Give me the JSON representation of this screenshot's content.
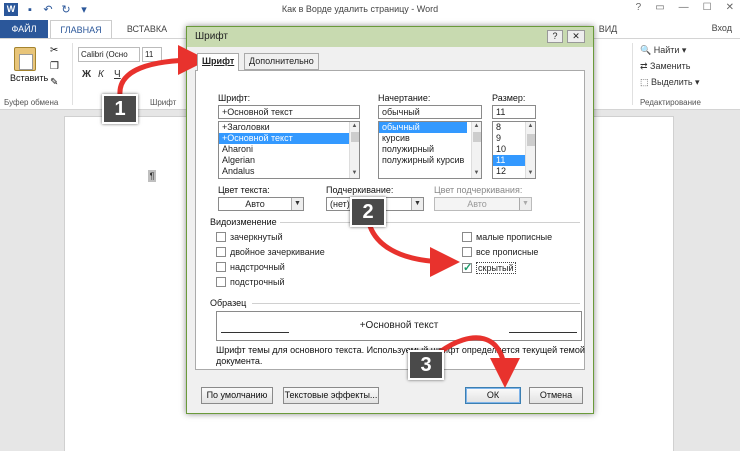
{
  "window": {
    "title": "Как в Ворде удалить страницу - Word",
    "signin": "Вход",
    "word_logo": "W",
    "controls": [
      "?",
      "▭",
      "—",
      "☐",
      "✕"
    ]
  },
  "ribbon": {
    "tabs": [
      "ФАЙЛ",
      "ГЛАВНАЯ",
      "ВСТАВКА",
      "ВИД"
    ],
    "paste_label": "Вставить",
    "clipboard_group": "Буфер обмена",
    "font_group": "Шрифт",
    "font_name": "Calibri (Осно",
    "font_size": "11",
    "format_buttons": [
      "Ж",
      "К",
      "Ч"
    ],
    "find": "Найти",
    "replace": "Заменить",
    "select": "Выделить",
    "editing_group": "Редактирование"
  },
  "document": {
    "pilcrow": "¶"
  },
  "dialog": {
    "title": "Шрифт",
    "help": "?",
    "close": "✕",
    "tabs": [
      "Шрифт",
      "Дополнительно"
    ],
    "font_label": "Шрифт:",
    "font_value": "+Основной текст",
    "font_list": [
      "+Заголовки",
      "+Основной текст",
      "Aharoni",
      "Algerian",
      "Andalus"
    ],
    "style_label": "Начертание:",
    "style_value": "обычный",
    "style_list": [
      "обычный",
      "курсив",
      "полужирный",
      "полужирный курсив"
    ],
    "size_label": "Размер:",
    "size_value": "11",
    "size_list": [
      "8",
      "9",
      "10",
      "11",
      "12"
    ],
    "color_label": "Цвет текста:",
    "color_value": "Авто",
    "underline_label": "Подчеркивание:",
    "underline_value": "(нет)",
    "underline_color_label": "Цвет подчеркивания:",
    "underline_color_value": "Авто",
    "effects_label": "Видоизменение",
    "effects_left": [
      "зачеркнутый",
      "двойное зачеркивание",
      "надстрочный",
      "подстрочный"
    ],
    "effects_right": [
      "малые прописные",
      "все прописные",
      "скрытый"
    ],
    "sample_label": "Образец",
    "sample_text": "+Основной текст",
    "description": "Шрифт темы для основного текста. Используемый шрифт определяется текущей темой документа.",
    "buttons": {
      "default": "По умолчанию",
      "effects": "Текстовые эффекты...",
      "ok": "ОК",
      "cancel": "Отмена"
    }
  },
  "annotations": {
    "badges": [
      "1",
      "2",
      "3"
    ],
    "arrow_color": "#e8322d"
  }
}
